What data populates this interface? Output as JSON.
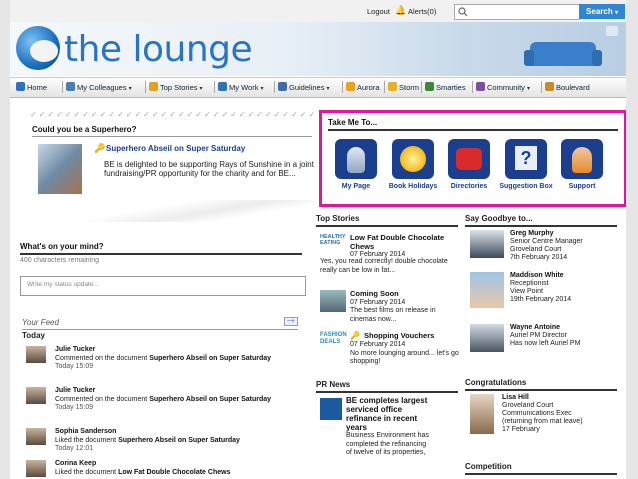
{
  "topbar": {
    "logout": "Logout",
    "alerts": "Alerts(0)",
    "search_placeholder": "",
    "search_button": "Search"
  },
  "brand": {
    "title": "the lounge"
  },
  "nav": [
    {
      "label": "Home",
      "color": "#2f6fc0",
      "dropdown": false
    },
    {
      "label": "My Colleagues",
      "color": "#4a7db3",
      "dropdown": true
    },
    {
      "label": "Top Stories",
      "color": "#e2a120",
      "dropdown": true
    },
    {
      "label": "My Work",
      "color": "#2e72b8",
      "dropdown": true
    },
    {
      "label": "Guidelines",
      "color": "#3f6fa8",
      "dropdown": true
    },
    {
      "label": "Aurora",
      "color": "#e9a21f",
      "dropdown": false
    },
    {
      "label": "Storm",
      "color": "#e6b028",
      "dropdown": false
    },
    {
      "label": "Smarties",
      "color": "#3a8a3a",
      "dropdown": false
    },
    {
      "label": "Community",
      "color": "#7a4fa0",
      "dropdown": true
    },
    {
      "label": "Boulevard",
      "color": "#c98a2a",
      "dropdown": false
    }
  ],
  "superhero": {
    "question": "Could you be a Superhero?",
    "story_title": "Superhero Abseil on Super Saturday",
    "story_body": "BE is delighted to be supporting Rays of Sunshine in a joint fundraising/PR opportunity for the charity and for BE..."
  },
  "take_me_to": {
    "title": "Take Me To...",
    "tiles": [
      {
        "label": "My Page",
        "icon": "person-icon"
      },
      {
        "label": "Book Holidays",
        "icon": "sun-icon"
      },
      {
        "label": "Directories",
        "icon": "phone-icon"
      },
      {
        "label": "Suggestion Box",
        "icon": "question-icon"
      },
      {
        "label": "Support",
        "icon": "headset-icon"
      }
    ]
  },
  "mind": {
    "title": "What's on your mind?",
    "remaining": "400 characters remaining",
    "placeholder": "Write my status update..."
  },
  "feed": {
    "title": "Your Feed",
    "controls": "−+",
    "today": "Today",
    "items": [
      {
        "name": "Julie Tucker",
        "action": "Commented on the document",
        "doc": "Superhero Abseil on Super Saturday",
        "time": "Today 15:09"
      },
      {
        "name": "Julie Tucker",
        "action": "Commented on the document",
        "doc": "Superhero Abseil on Super Saturday",
        "time": "Today 15:09"
      },
      {
        "name": "Sophia Sanderson",
        "action": "Liked the document",
        "doc": "Superhero Abseil on Super Saturday",
        "time": "Today 12:01"
      },
      {
        "name": "Corina Keep",
        "action": "Liked the document",
        "doc": "Low Fat Double Chocolate Chews",
        "time": ""
      }
    ]
  },
  "top_stories": {
    "title": "Top Stories",
    "items": [
      {
        "title": "Low Fat Double Chocolate Chews",
        "date": "07 February 2014",
        "body": "Yes, you read correctly! double chocolate really can be low in fat...",
        "thumb": "HEALTHY EATING"
      },
      {
        "title": "Coming Soon",
        "date": "07 February 2014",
        "body": "The best films on release in cinemas now...",
        "thumb": ""
      },
      {
        "title": "Shopping Vouchers",
        "date": "07 February 2014",
        "body": "No more lounging around... let's go shopping!",
        "thumb": "FASHION DEALS"
      }
    ]
  },
  "goodbye": {
    "title": "Say Goodbye to...",
    "people": [
      {
        "name": "Greg Murphy",
        "l1": "Senior Centre Manager",
        "l2": "Groveland Court",
        "l3": "7th February 2014"
      },
      {
        "name": "Maddison White",
        "l1": "Receptionist",
        "l2": "View Point",
        "l3": "19th February 2014"
      },
      {
        "name": "Wayne Antoine",
        "l1": "Auriel PM Director",
        "l2": "Has now left Auriel PM",
        "l3": ""
      }
    ]
  },
  "pr_news": {
    "title": "PR News",
    "headline": "BE completes largest serviced office refinance in recent years",
    "body": "Business Environment has completed the refinancing of twelve of its properties,"
  },
  "congrats": {
    "title": "Congratulations",
    "name": "Lisa Hill",
    "l1": "Groveland Court",
    "l2": "Communications Exec",
    "l3": "(returning from mat leave)",
    "l4": "17 February"
  },
  "competition": {
    "title": "Competition"
  }
}
